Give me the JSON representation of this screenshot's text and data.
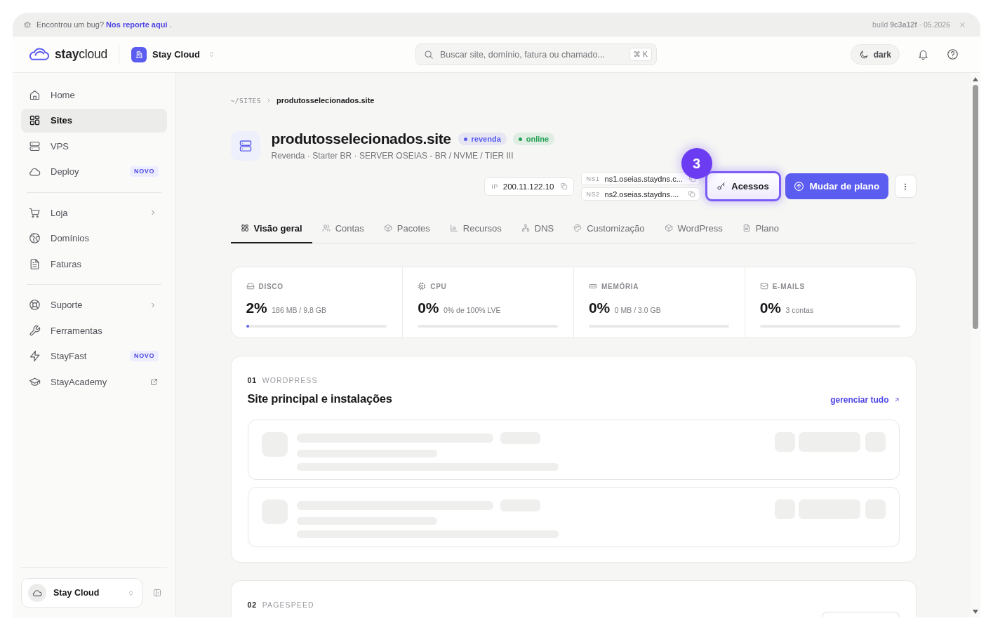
{
  "banner": {
    "message": "Encontrou um bug?",
    "link": "Nos reporte aqui",
    "message_end": ".",
    "build": "build **9c3a12f** · 05.2026"
  },
  "header": {
    "logo": "**stay**cloud",
    "workspace": "Stay Cloud",
    "search": {
      "placeholder": "Buscar site, domínio, fatura ou chamado...",
      "shortcut": "⌘ K"
    },
    "theme_toggle": "dark"
  },
  "sidebar": {
    "sections": [
      {
        "items": [
          {
            "label": "Home",
            "kind": "link",
            "selected": false
          },
          {
            "label": "Sites",
            "kind": "link",
            "selected": true
          },
          {
            "label": "VPS",
            "kind": "link",
            "selected": false
          },
          {
            "label": "Deploy",
            "kind": "link",
            "badge": "NOVO",
            "selected": false
          }
        ]
      },
      {
        "items": [
          {
            "label": "Loja",
            "kind": "submenu",
            "selected": false
          },
          {
            "label": "Domínios",
            "kind": "link",
            "selected": false
          },
          {
            "label": "Faturas",
            "kind": "link",
            "selected": false
          }
        ]
      },
      {
        "items": [
          {
            "label": "Suporte",
            "kind": "submenu",
            "selected": false
          },
          {
            "label": "Ferramentas",
            "kind": "link",
            "selected": false
          },
          {
            "label": "StayFast",
            "kind": "link",
            "badge": "NOVO",
            "selected": false
          },
          {
            "label": "StayAcademy",
            "kind": "external",
            "selected": false
          }
        ]
      }
    ],
    "account": "Stay Cloud"
  },
  "breadcrumb": [
    {
      "label": "~/SITES",
      "current": false
    },
    {
      "label": "produtosselecionados.site",
      "current": true
    }
  ],
  "site": {
    "name": "produtosselecionados.site",
    "tags": [
      {
        "label": "revenda",
        "color": "#5b5cf0"
      },
      {
        "label": "online",
        "color": "#22a055"
      }
    ],
    "subtitle": "Revenda · Starter BR · SERVER OSEIAS - BR / NVME / TIER III"
  },
  "actions": {
    "ip": {
      "label": "IP",
      "value": "200.11.122.10"
    },
    "nameservers": [
      {
        "label": "NS1",
        "value": "ns1.oseias.staydns.c..."
      },
      {
        "label": "NS2",
        "value": "ns2.oseias.staydns...."
      }
    ],
    "access_button": {
      "label": "Acessos",
      "highlighted": true,
      "step": "3"
    },
    "primary_button": "Mudar de plano"
  },
  "tabs": [
    {
      "label": "Visão geral",
      "selected": true
    },
    {
      "label": "Contas",
      "selected": false
    },
    {
      "label": "Pacotes",
      "selected": false
    },
    {
      "label": "Recursos",
      "selected": false
    },
    {
      "label": "DNS",
      "selected": false
    },
    {
      "label": "Customização",
      "selected": false
    },
    {
      "label": "WordPress",
      "selected": false
    },
    {
      "label": "Plano",
      "selected": false
    }
  ],
  "stats": [
    {
      "label": "DISCO",
      "value": "2%",
      "detail": "186 MB / 9.8 GB",
      "level": 0.02
    },
    {
      "label": "CPU",
      "value": "0%",
      "detail": "0% de 100% LVE"
    },
    {
      "label": "MEMÓRIA",
      "value": "0%",
      "detail": "0 MB / 3.0 GB"
    },
    {
      "label": "E-MAILS",
      "value": "0%",
      "detail": "3 contas"
    }
  ],
  "sections": [
    {
      "number": "01",
      "label": "WORDPRESS",
      "title": "Site principal e instalações",
      "link": "gerenciar tudo",
      "rows": [
        {
          "loading": true
        },
        {
          "loading": true
        }
      ]
    },
    {
      "number": "02",
      "label": "PAGESPEED",
      "button_cut_off": true
    }
  ]
}
